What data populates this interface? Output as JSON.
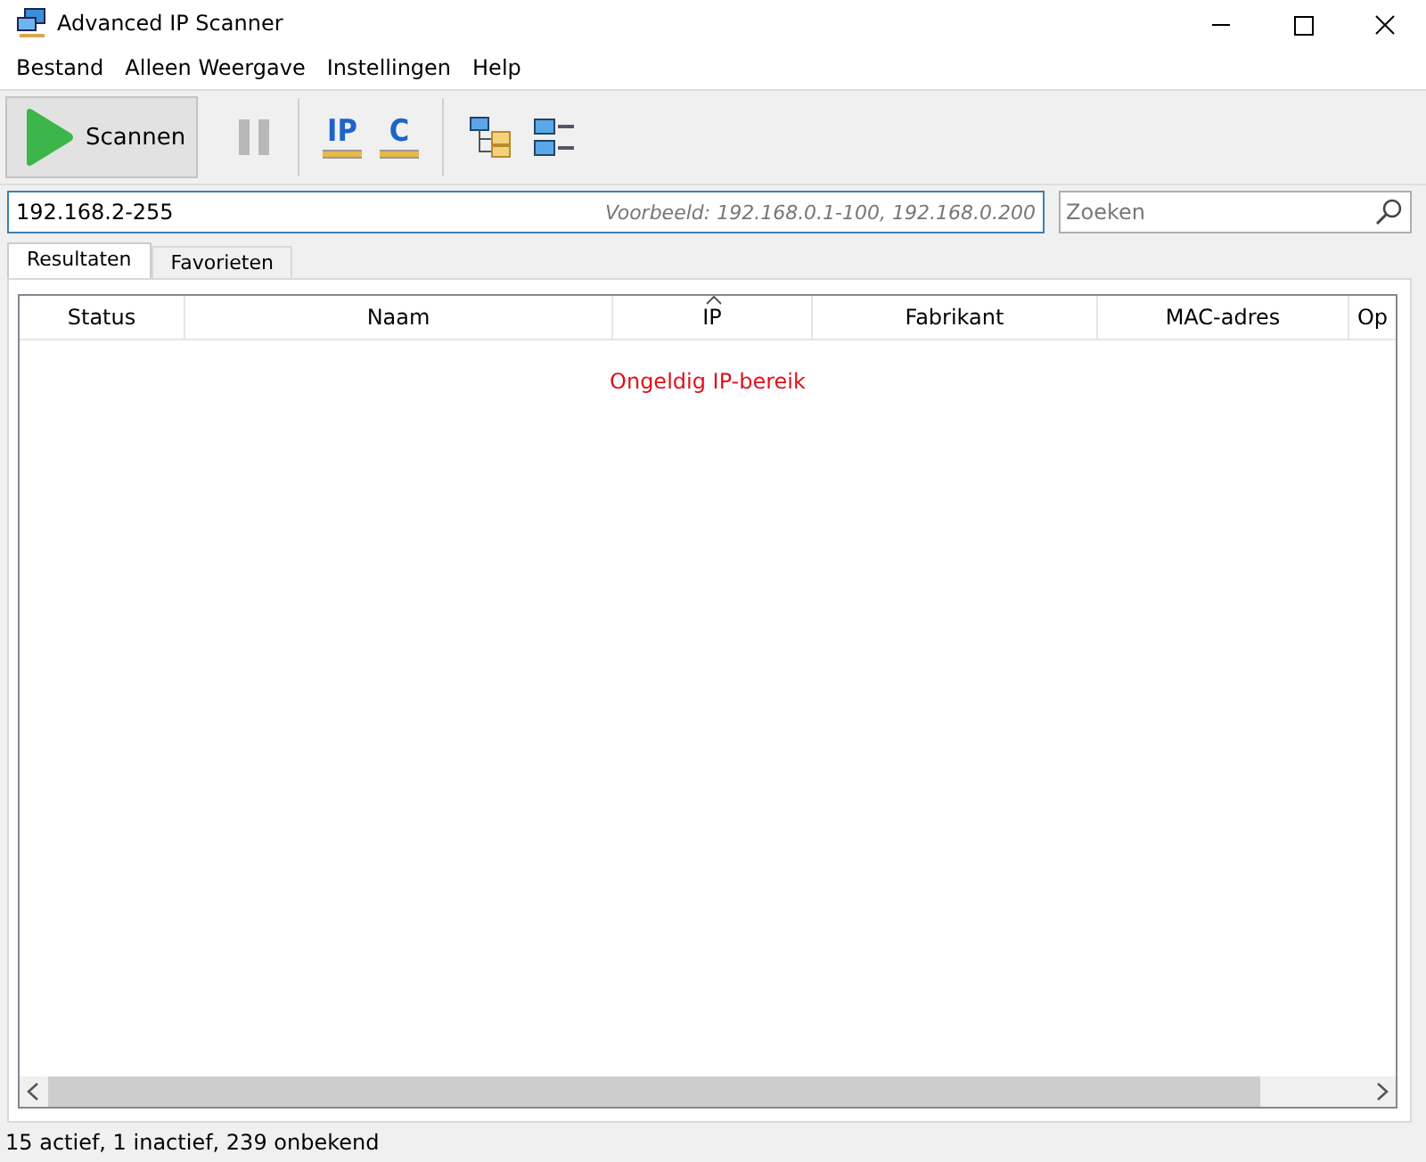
{
  "window": {
    "title": "Advanced IP Scanner"
  },
  "menu": [
    "Bestand",
    "Alleen Weergave",
    "Instellingen",
    "Help"
  ],
  "toolbar": [
    {
      "kind": "scan",
      "label": "Scannen"
    },
    {
      "kind": "pause",
      "disabled": true
    },
    {
      "kind": "separator"
    },
    {
      "kind": "letter",
      "label": "IP"
    },
    {
      "kind": "letter",
      "label": "C"
    },
    {
      "kind": "separator"
    },
    {
      "kind": "tree"
    },
    {
      "kind": "list"
    }
  ],
  "range": {
    "value": "192.168.2-255",
    "placeholder": "Voorbeeld: 192.168.0.1-100, 192.168.0.200"
  },
  "search": {
    "placeholder": "Zoeken"
  },
  "tabs": [
    {
      "label": "Resultaten",
      "selected": true
    },
    {
      "label": "Favorieten",
      "selected": false
    }
  ],
  "table": {
    "columns": [
      {
        "label": "Status",
        "sorted": false
      },
      {
        "label": "Naam",
        "sorted": false
      },
      {
        "label": "IP",
        "sorted": true
      },
      {
        "label": "Fabrikant",
        "sorted": false
      },
      {
        "label": "MAC-adres",
        "sorted": false
      },
      {
        "label": "Op",
        "sorted": false
      }
    ],
    "message": "Ongeldig IP-bereik"
  },
  "status_bar": "15 actief, 1 inactief, 239 onbekend"
}
